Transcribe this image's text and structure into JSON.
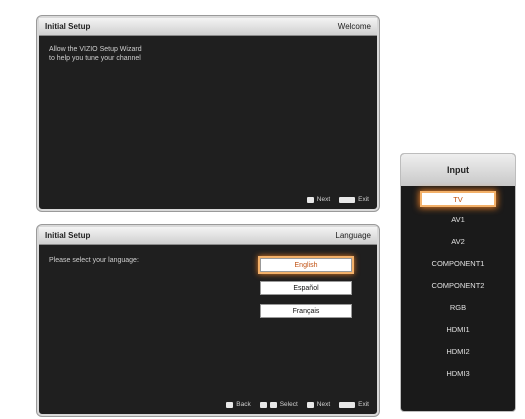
{
  "welcome_panel": {
    "title": "Initial Setup",
    "step": "Welcome",
    "message_line1": "Allow the VIZIO Setup Wizard",
    "message_line2": "to help you tune your channel",
    "footer": {
      "next": "Next",
      "exit": "Exit"
    }
  },
  "language_panel": {
    "title": "Initial Setup",
    "step": "Language",
    "prompt": "Please select your language:",
    "options": [
      "English",
      "Español",
      "Français"
    ],
    "selected": "English",
    "footer": {
      "back": "Back",
      "select": "Select",
      "next": "Next",
      "exit": "Exit"
    }
  },
  "input_panel": {
    "title": "Input",
    "items": [
      "TV",
      "AV1",
      "AV2",
      "COMPONENT1",
      "COMPONENT2",
      "RGB",
      "HDMI1",
      "HDMI2",
      "HDMI3"
    ],
    "selected": "TV"
  },
  "colors": {
    "accent": "#e07a25",
    "panel_bg": "#1f1f1f",
    "header_bg": "#d8d8d8"
  }
}
